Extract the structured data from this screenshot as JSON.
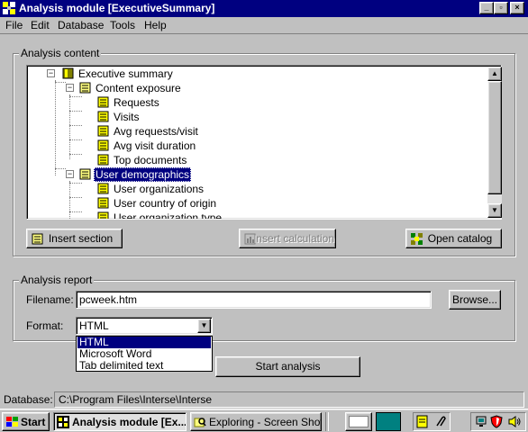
{
  "window": {
    "title": "Analysis module [ExecutiveSummary]",
    "controls": {
      "minimize": "_",
      "restore": "▫",
      "close": "×"
    }
  },
  "menu": [
    "File",
    "Edit",
    "Database",
    "Tools",
    "Help"
  ],
  "content_group": {
    "label": "Analysis content",
    "tree": {
      "root": "Executive summary",
      "sections": [
        {
          "label": "Content exposure",
          "items": [
            "Requests",
            "Visits",
            "Avg requests/visit",
            "Avg visit duration",
            "Top documents"
          ]
        },
        {
          "label": "User demographics",
          "selected": true,
          "items": [
            "User organizations",
            "User country of origin",
            "User organization type"
          ]
        }
      ]
    },
    "buttons": {
      "insert_section": "Insert section",
      "insert_calculation": "Insert calculation",
      "open_catalog": "Open catalog"
    }
  },
  "report_group": {
    "label": "Analysis report",
    "filename_label": "Filename:",
    "filename_value": "pcweek.htm",
    "browse": "Browse...",
    "format_label": "Format:",
    "format_value": "HTML",
    "format_options": [
      "HTML",
      "Microsoft Word",
      "Tab delimited text"
    ],
    "start": "Start analysis"
  },
  "status": {
    "label": "Database:",
    "path": "C:\\Program Files\\Interse\\Interse"
  },
  "taskbar": {
    "start": "Start",
    "tasks": [
      "Analysis module [Ex...",
      "Exploring - Screen Shots"
    ]
  },
  "colors": {
    "titlebar": "#000080",
    "face": "#c0c0c0",
    "selection": "#000080",
    "tray_teal": "#008080"
  }
}
